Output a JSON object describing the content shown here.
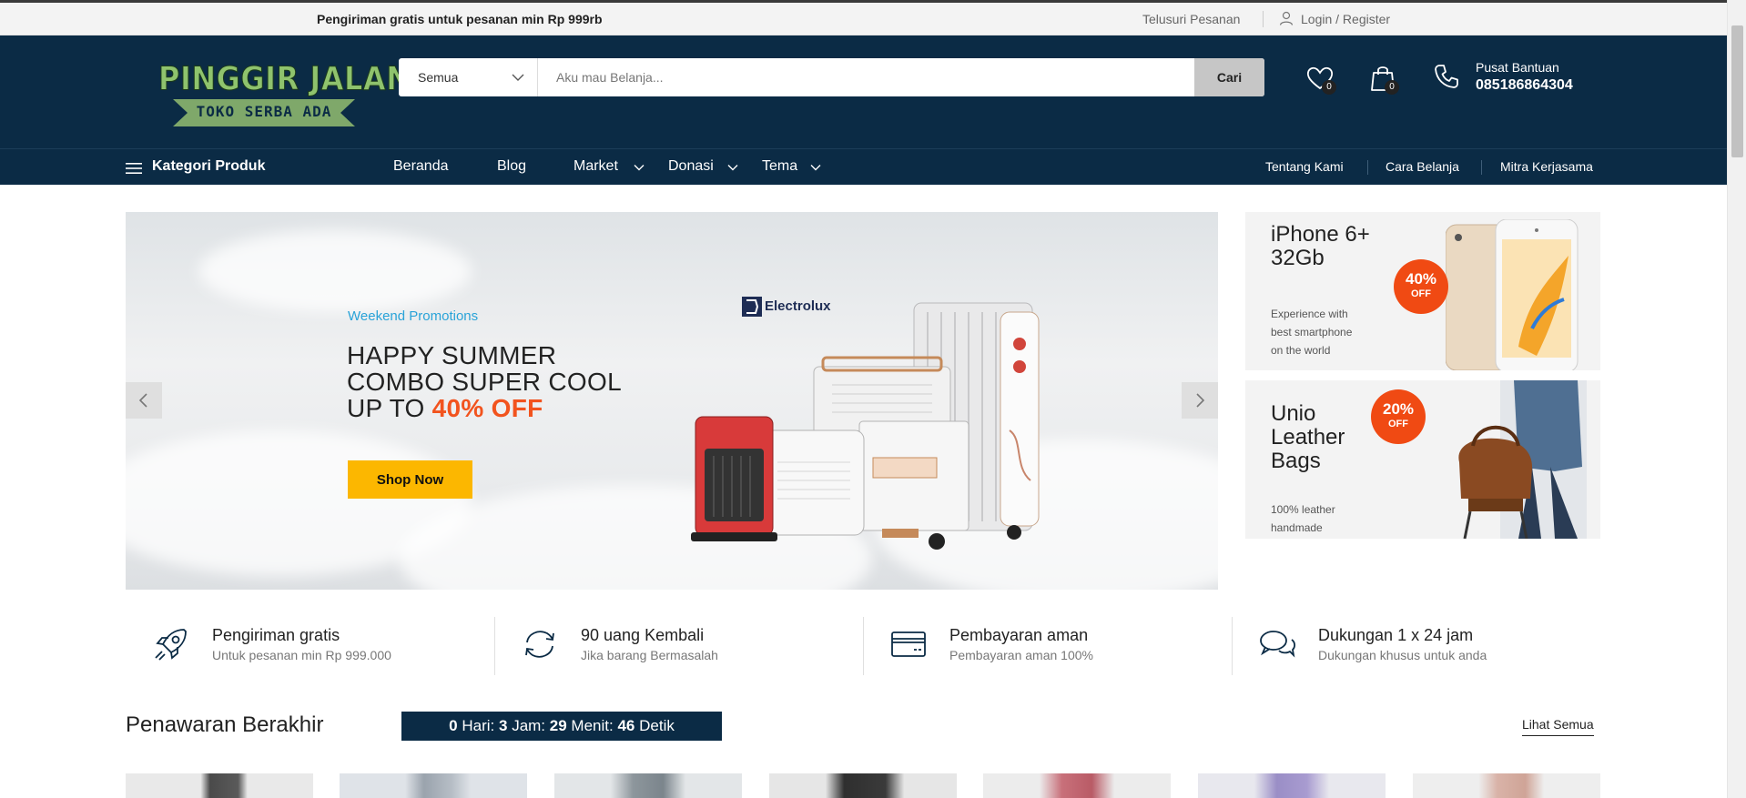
{
  "topbar": {
    "promo": "Pengiriman gratis untuk pesanan min Rp 999rb",
    "track_order": "Telusuri Pesanan",
    "login": "Login / Register"
  },
  "header": {
    "logo_top": "PINGGIR JALAN",
    "logo_bottom": "TOKO SERBA ADA",
    "search_category": "Semua",
    "search_placeholder": "Aku mau Belanja...",
    "search_button": "Cari",
    "wishlist_count": "0",
    "cart_count": "0",
    "help_title": "Pusat Bantuan",
    "help_phone": "085186864304"
  },
  "nav": {
    "categories_label": "Kategori Produk",
    "menu": [
      {
        "label": "Beranda"
      },
      {
        "label": "Blog"
      },
      {
        "label": "Market"
      },
      {
        "label": "Donasi"
      },
      {
        "label": "Tema"
      }
    ],
    "right_links": [
      {
        "label": "Tentang Kami"
      },
      {
        "label": "Cara Belanja"
      },
      {
        "label": "Mitra Kerjasama"
      }
    ]
  },
  "hero": {
    "kicker": "Weekend Promotions",
    "line1": "HAPPY SUMMER",
    "line2": "COMBO SUPER COOL",
    "line3_prefix": "UP TO",
    "line3_highlight": "40% OFF",
    "cta": "Shop Now",
    "brand": "Electrolux"
  },
  "side_banners": [
    {
      "title_1": "iPhone 6+",
      "title_2": "32Gb",
      "sub_1": "Experience with",
      "sub_2": "best smartphone",
      "sub_3": "on the world",
      "badge_pct": "40%",
      "badge_off": "OFF"
    },
    {
      "title_1": "Unio",
      "title_2": "Leather",
      "title_3": "Bags",
      "sub_1": "100% leather",
      "sub_2": "handmade",
      "badge_pct": "20%",
      "badge_off": "OFF"
    }
  ],
  "features": [
    {
      "title": "Pengiriman gratis",
      "sub": "Untuk pesanan min Rp 999.000",
      "icon": "rocket-icon"
    },
    {
      "title": "90 uang Kembali",
      "sub": "Jika barang Bermasalah",
      "icon": "refresh-icon"
    },
    {
      "title": "Pembayaran aman",
      "sub": "Pembayaran aman 100%",
      "icon": "credit-card-icon"
    },
    {
      "title": "Dukungan 1 x 24 jam",
      "sub": "Dukungan khusus untuk anda",
      "icon": "chat-icon"
    }
  ],
  "deals": {
    "title": "Penawaran Berakhir",
    "days": "0",
    "days_label": "Hari:",
    "hours": "3",
    "hours_label": "Jam:",
    "minutes": "29",
    "minutes_label": "Menit:",
    "seconds": "46",
    "seconds_label": "Detik",
    "see_all": "Lihat Semua"
  },
  "colors": {
    "header_bg": "#0b2b45",
    "accent_orange": "#f2531e",
    "cta_yellow": "#fcb700",
    "kicker_blue": "#29a3d8"
  }
}
